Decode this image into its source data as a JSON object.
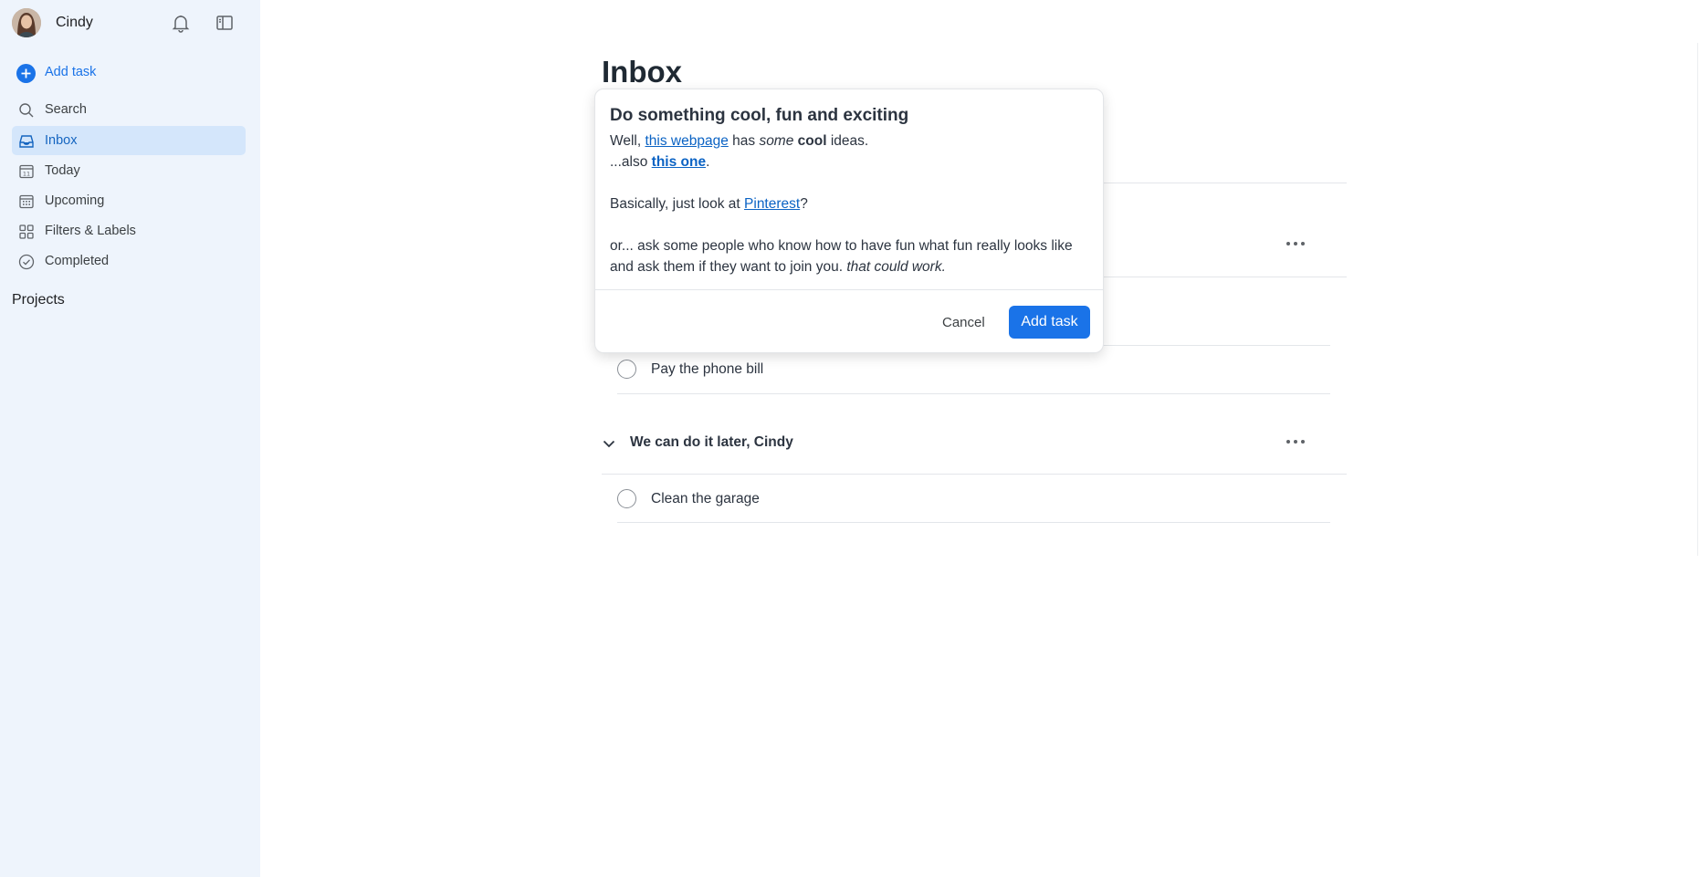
{
  "user": {
    "name": "Cindy"
  },
  "sidebar": {
    "add_task": "Add task",
    "items": [
      {
        "label": "Search",
        "icon": "search-icon"
      },
      {
        "label": "Inbox",
        "icon": "inbox-icon",
        "active": true
      },
      {
        "label": "Today",
        "icon": "calendar-today-icon"
      },
      {
        "label": "Upcoming",
        "icon": "calendar-grid-icon"
      },
      {
        "label": "Filters & Labels",
        "icon": "grid-icon"
      },
      {
        "label": "Completed",
        "icon": "check-circle-icon"
      }
    ],
    "projects_label": "Projects"
  },
  "main": {
    "title": "Inbox",
    "tasks": [
      {
        "label": "Pay the phone bill"
      },
      {
        "label": "Clean the garage"
      }
    ],
    "section": {
      "title": "We can do it later, Cindy"
    }
  },
  "dialog": {
    "title": "Do something cool, fun and exciting",
    "line1": {
      "pre": "Well, ",
      "link": "this webpage",
      "mid": " has ",
      "em": "some",
      "space": " ",
      "strong": "cool",
      "post": " ideas."
    },
    "line2": {
      "pre": "...also ",
      "link": "this one",
      "post": "."
    },
    "line3": {
      "pre": "Basically, just look at ",
      "link": "Pinterest",
      "post": "?"
    },
    "line4": {
      "pre": "or... ask some people who know how to have fun what fun really looks like and ask them if they want to join you. ",
      "em": "that could work."
    },
    "cancel": "Cancel",
    "submit": "Add task"
  },
  "colors": {
    "accent": "#1a73e8",
    "sidebar_bg": "#eef4fc",
    "active_bg": "#d4e6fb",
    "link": "#0b63c4"
  }
}
